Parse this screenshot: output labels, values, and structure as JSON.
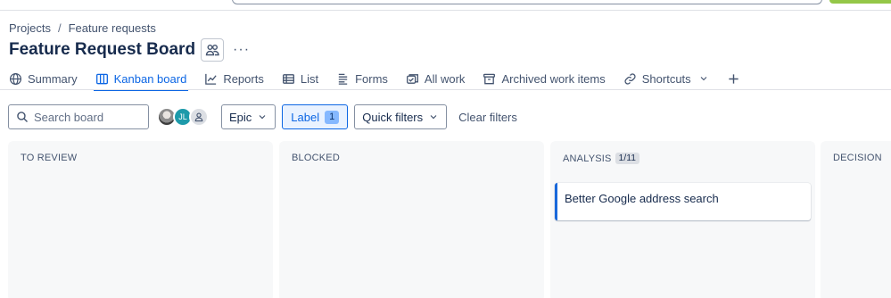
{
  "breadcrumb": {
    "project": "Projects",
    "separator": "/",
    "current": "Feature requests"
  },
  "page": {
    "title": "Feature Request Board",
    "more": "···"
  },
  "tabs": [
    {
      "label": "Summary",
      "icon": "globe-icon"
    },
    {
      "label": "Kanban board",
      "icon": "board-icon",
      "active": true
    },
    {
      "label": "Reports",
      "icon": "chart-line-icon"
    },
    {
      "label": "List",
      "icon": "list-icon"
    },
    {
      "label": "Forms",
      "icon": "form-icon"
    },
    {
      "label": "All work",
      "icon": "all-work-icon"
    },
    {
      "label": "Archived work items",
      "icon": "archive-icon"
    },
    {
      "label": "Shortcuts",
      "icon": "link-icon"
    }
  ],
  "filters": {
    "search_placeholder": "Search board",
    "avatar2_initials": "JL",
    "epic": "Epic",
    "label": "Label",
    "label_count": "1",
    "quick_filters": "Quick filters",
    "clear": "Clear filters"
  },
  "columns": [
    {
      "title": "TO REVIEW",
      "count": "",
      "cards": []
    },
    {
      "title": "BLOCKED",
      "count": "",
      "cards": []
    },
    {
      "title": "ANALYSIS",
      "count": "1/11",
      "cards": [
        {
          "title": "Better Google address search"
        }
      ]
    },
    {
      "title": "DECISION",
      "count": "",
      "cards": []
    }
  ],
  "colors": {
    "accent": "#0c66e4",
    "column_bg": "#f7f8f9",
    "label_active_bg": "#e9f2ff"
  }
}
